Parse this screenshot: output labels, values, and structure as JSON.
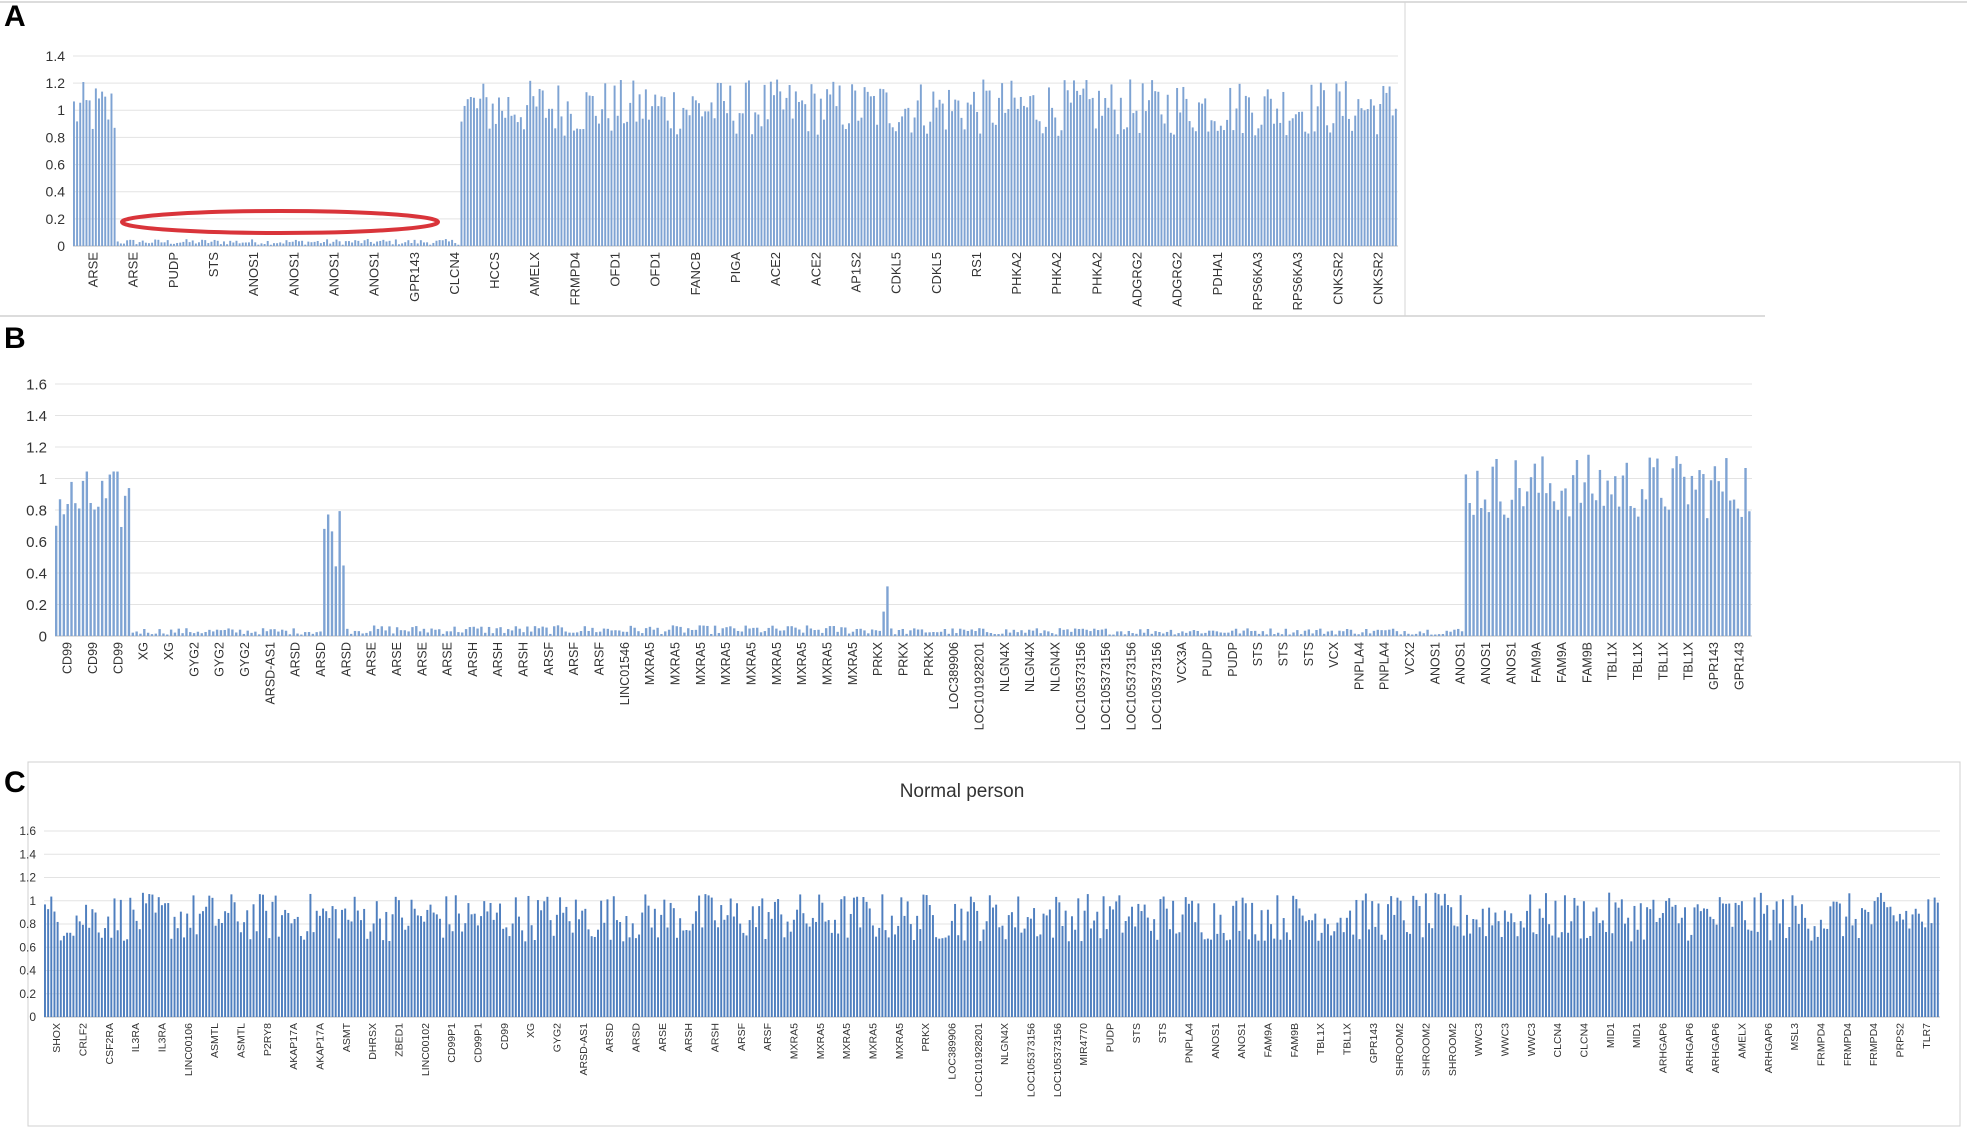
{
  "panels": [
    {
      "letter": "A"
    },
    {
      "letter": "B"
    },
    {
      "letter": "C"
    }
  ],
  "chart_data": [
    {
      "type": "bar",
      "panel": "A",
      "title": "",
      "ylim": [
        0,
        1.4
      ],
      "yticks": [
        "1.4",
        "1.2",
        "1",
        "0.8",
        "0.6",
        "0.4",
        "0.2",
        "0"
      ],
      "grid": true,
      "series_color": "#7ea3d3",
      "annotation": {
        "type": "ellipse",
        "color": "#d9343a",
        "around": "deleted region (ARSE–GPR143)"
      },
      "categories": [
        "ARSE",
        "ARSE",
        "PUDP",
        "STS",
        "ANOS1",
        "ANOS1",
        "ANOS1",
        "ANOS1",
        "GPR143",
        "CLCN4",
        "HCCS",
        "AMELX",
        "FRMPD4",
        "OFD1",
        "OFD1",
        "FANCB",
        "PIGA",
        "ACE2",
        "ACE2",
        "AP1S2",
        "CDKL5",
        "CDKL5",
        "RS1",
        "PHKA2",
        "PHKA2",
        "PHKA2",
        "ADGRG2",
        "ADGRG2",
        "PDHA1",
        "RPS6KA3",
        "RPS6KA3",
        "CNKSR2",
        "CNKSR2"
      ],
      "segments": [
        {
          "label": "ARSE–ARSE (normal)",
          "bars": 14,
          "mean": 1.0
        },
        {
          "label": "ARSE–GPR143 (deleted)",
          "bars": 110,
          "mean": 0.03
        },
        {
          "label": "GPR143–CNKSR2 (normal)",
          "bars": 300,
          "mean": 1.02
        }
      ]
    },
    {
      "type": "bar",
      "panel": "B",
      "title": "",
      "ylim": [
        0,
        1.6
      ],
      "yticks": [
        "1.6",
        "1.4",
        "1.2",
        "1",
        "0.8",
        "0.6",
        "0.4",
        "0.2",
        "0"
      ],
      "grid": true,
      "series_color": "#7ea3d3",
      "categories": [
        "CD99",
        "CD99",
        "CD99",
        "XG",
        "XG",
        "GYG2",
        "GYG2",
        "GYG2",
        "ARSD-AS1",
        "ARSD",
        "ARSD",
        "ARSD",
        "ARSE",
        "ARSE",
        "ARSE",
        "ARSE",
        "ARSH",
        "ARSH",
        "ARSH",
        "ARSF",
        "ARSF",
        "ARSF",
        "LINC01546",
        "MXRA5",
        "MXRA5",
        "MXRA5",
        "MXRA5",
        "MXRA5",
        "MXRA5",
        "MXRA5",
        "MXRA5",
        "MXRA5",
        "PRKX",
        "PRKX",
        "PRKX",
        "LOC389906",
        "LOC101928201",
        "NLGN4X",
        "NLGN4X",
        "NLGN4X",
        "LOC105373156",
        "LOC105373156",
        "LOC105373156",
        "LOC105373156",
        "VCX3A",
        "PUDP",
        "PUDP",
        "STS",
        "STS",
        "STS",
        "VCX",
        "PNPLA4",
        "PNPLA4",
        "VCX2",
        "ANOS1",
        "ANOS1",
        "ANOS1",
        "ANOS1",
        "FAM9A",
        "FAM9A",
        "FAM9B",
        "TBL1X",
        "TBL1X",
        "TBL1X",
        "TBL1X",
        "GPR143",
        "GPR143"
      ],
      "segments": [
        {
          "label": "CD99–XG",
          "bars": 20,
          "mean": 0.85
        },
        {
          "label": "XG–ARSD",
          "bars": 50,
          "mean": 0.03
        },
        {
          "label": "ARSD peak",
          "bars": 6,
          "mean": 0.65
        },
        {
          "label": "ARSD–PRKX",
          "bars": 140,
          "mean": 0.04
        },
        {
          "label": "PRKX peak",
          "bars": 2,
          "mean": 0.3
        },
        {
          "label": "PRKX–ANOS1",
          "bars": 150,
          "mean": 0.03
        },
        {
          "label": "ANOS1–GPR143",
          "bars": 75,
          "mean": 0.95
        }
      ]
    },
    {
      "type": "bar",
      "panel": "C",
      "title": "Normal person",
      "ylim": [
        0,
        1.6
      ],
      "yticks": [
        "1.6",
        "1.4",
        "1.2",
        "1",
        "0.8",
        "0.6",
        "0.4",
        "0.2",
        "0"
      ],
      "grid": true,
      "series_color": "#4f7fbf",
      "categories": [
        "SHOX",
        "CRLF2",
        "CSF2RA",
        "IL3RA",
        "IL3RA",
        "LINC00106",
        "ASMTL",
        "ASMTL",
        "P2RY8",
        "AKAP17A",
        "AKAP17A",
        "ASMT",
        "DHRSX",
        "ZBED1",
        "LINC00102",
        "CD99P1",
        "CD99P1",
        "CD99",
        "XG",
        "GYG2",
        "ARSD-AS1",
        "ARSD",
        "ARSD",
        "ARSE",
        "ARSH",
        "ARSH",
        "ARSF",
        "ARSF",
        "MXRA5",
        "MXRA5",
        "MXRA5",
        "MXRA5",
        "MXRA5",
        "PRKX",
        "LOC389906",
        "LOC101928201",
        "NLGN4X",
        "LOC105373156",
        "LOC105373156",
        "MIR4770",
        "PUDP",
        "STS",
        "STS",
        "PNPLA4",
        "ANOS1",
        "ANOS1",
        "FAM9A",
        "FAM9B",
        "TBL1X",
        "TBL1X",
        "GPR143",
        "SHROOM2",
        "SHROOM2",
        "SHROOM2",
        "WWC3",
        "WWC3",
        "WWC3",
        "CLCN4",
        "CLCN4",
        "MID1",
        "MID1",
        "ARHGAP6",
        "ARHGAP6",
        "ARHGAP6",
        "AMELX",
        "ARHGAP6",
        "MSL3",
        "FRMPD4",
        "FRMPD4",
        "FRMPD4",
        "PRPS2",
        "TLR7"
      ],
      "segments": [
        {
          "label": "SHOX–TLR7",
          "bars": 600,
          "mean": 0.86
        }
      ]
    }
  ]
}
